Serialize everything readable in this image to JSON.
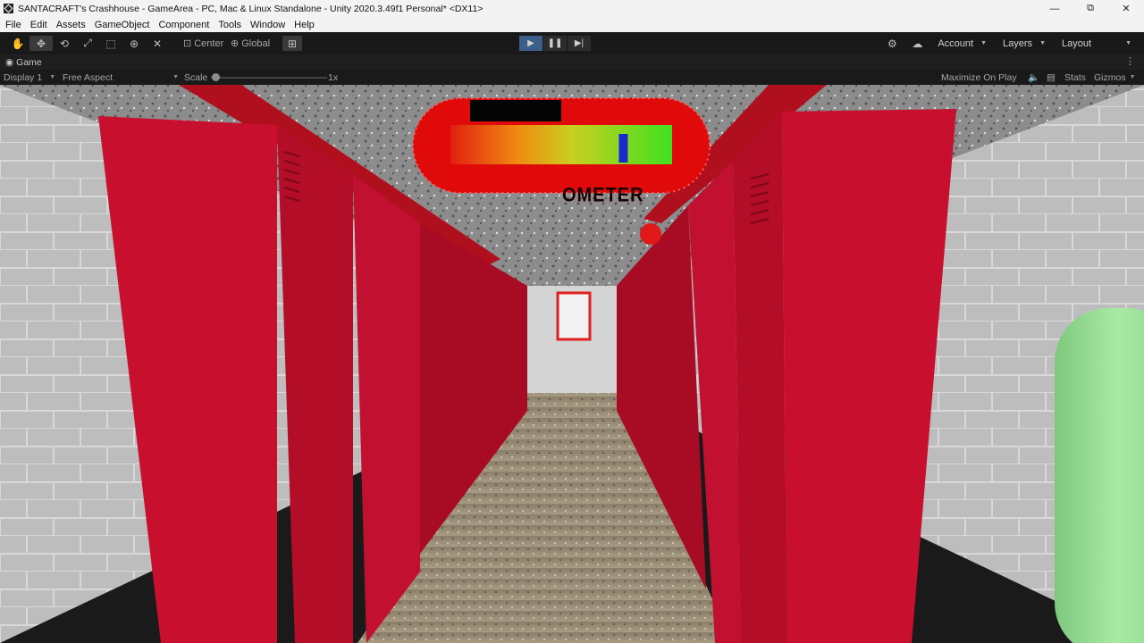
{
  "window": {
    "title": "SANTACRAFT's Crashhouse - GameArea - PC, Mac & Linux Standalone - Unity 2020.3.49f1 Personal* <DX11>",
    "controls": [
      "—",
      "⧉",
      "✕"
    ]
  },
  "menu": [
    "File",
    "Edit",
    "Assets",
    "GameObject",
    "Component",
    "Tools",
    "Window",
    "Help"
  ],
  "toolbar": {
    "pivot_label": "Center",
    "space_label": "Global",
    "account_label": "Account",
    "layers_label": "Layers",
    "layout_label": "Layout"
  },
  "game_tab": {
    "label": "Game"
  },
  "game_controls": {
    "display": "Display 1",
    "aspect": "Free Aspect",
    "scale_label": "Scale",
    "scale_value": "1x",
    "maximize": "Maximize On Play",
    "stats": "Stats",
    "gizmos": "Gizmos"
  },
  "hud": {
    "meter_label": "OMETER",
    "meter_level": 0.78
  },
  "colors": {
    "locker_red": "#c8102e",
    "toolbar_bg": "#191919",
    "play_active": "#3c5f8a"
  }
}
